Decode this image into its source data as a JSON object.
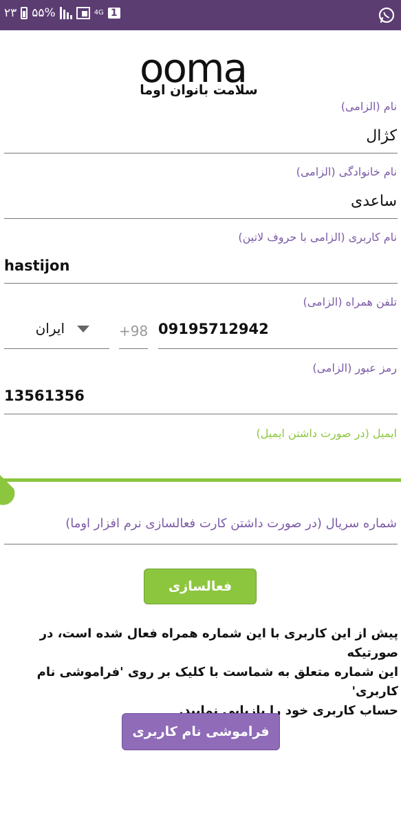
{
  "status_bar": {
    "time": "۲۳",
    "battery": "۵۵%",
    "network": "4G",
    "sim": "1",
    "colors": {
      "background": "#5b3d72"
    }
  },
  "logo": {
    "word": "ooma",
    "subtitle": "سلامت بانوان اوما"
  },
  "form": {
    "first_name": {
      "label": "نام (الزامی)",
      "value": "کژال"
    },
    "last_name": {
      "label": "نام خانوادگی (الزامی)",
      "value": "ساعدی"
    },
    "username": {
      "label": "نام کاربری (الزامی با حروف لاتین)",
      "value": "hastijon"
    },
    "phone": {
      "label": "تلفن همراه (الزامی)",
      "country": "ایران",
      "code": "+98",
      "value": "09195712942"
    },
    "password": {
      "label": "رمز عبور (الزامی)",
      "value": "13561356"
    },
    "email": {
      "label": "ایمیل (در صورت داشتن ایمیل)",
      "value": ""
    },
    "serial": {
      "placeholder": "شماره سریال (در صورت داشتن کارت فعالسازی نرم افزار اوما)"
    }
  },
  "buttons": {
    "activate": "فعالسازی",
    "forgot_username": "فراموشی نام کاربری"
  },
  "info_text": "پیش از این کاربری با این شماره همراه فعال شده است، در صورتیکه\nاین شماره متعلق به شماست با کلیک بر روی 'فراموشی نام کاربری'\nحساب کاربری خود را بازیابی نمایید.",
  "colors": {
    "accent_purple": "#7b5aa6",
    "accent_green": "#8cc63f",
    "button_purple": "#8f6bb8"
  },
  "icons": {
    "whatsapp": "whatsapp-icon",
    "dropdown": "chevron-down-icon",
    "battery": "battery-icon",
    "signal": "signal-icon"
  }
}
